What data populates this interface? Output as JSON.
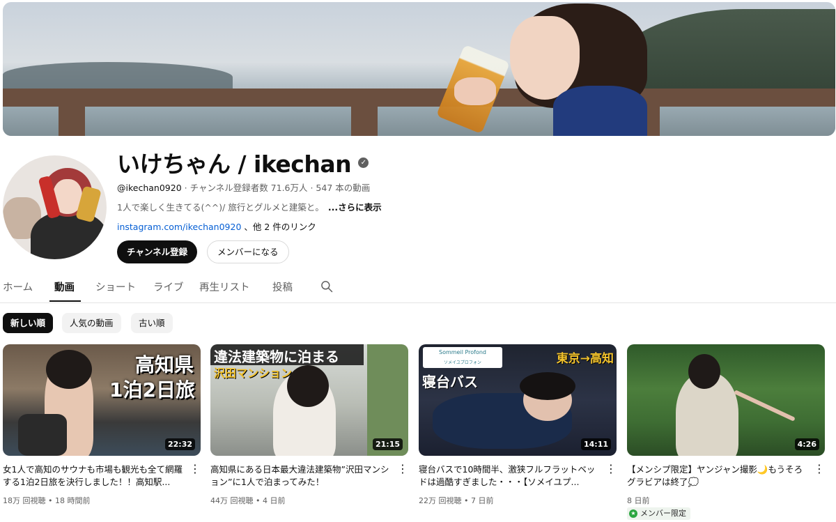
{
  "channel": {
    "name": "いけちゃん / ikechan",
    "verified_icon": "check-circle-icon",
    "handle": "@ikechan0920",
    "stats": " · チャンネル登録者数 71.6万人 · 547 本の動画",
    "description": "1人で楽しく生きてる(^^)/ 旅行とグルメと建築と。",
    "more": "...さらに表示",
    "link": "instagram.com/ikechan0920",
    "link_more": "、他 2 件のリンク",
    "subscribe_label": "チャンネル登録",
    "member_label": "メンバーになる"
  },
  "tabs": [
    {
      "label": "ホーム"
    },
    {
      "label": "動画"
    },
    {
      "label": "ショート"
    },
    {
      "label": "ライブ"
    },
    {
      "label": "再生リスト"
    },
    {
      "label": "投稿"
    }
  ],
  "active_tab": "動画",
  "filters": [
    {
      "label": "新しい順"
    },
    {
      "label": "人気の動画"
    },
    {
      "label": "古い順"
    }
  ],
  "videos": [
    {
      "title": "女1人で高知のサウナも市場も観光も全て網羅する1泊2日旅を決行しました！！高知駅...",
      "meta": "18万 回視聴 • 18 時間前",
      "duration": "22:32",
      "overlay1": "高知県",
      "overlay2": "1泊2日旅"
    },
    {
      "title": "高知県にある日本最大違法建築物”沢田マンション”に1人で泊まってみた！",
      "meta": "44万 回視聴 • 4 日前",
      "duration": "21:15",
      "overlay1": "違法建築物に泊まる",
      "overlay2": "沢田マンション"
    },
    {
      "title": "寝台バスで10時間半、激狭フルフラットベッドは過酷すぎました・・・【ソメイユプ...",
      "meta": "22万 回視聴 • 7 日前",
      "duration": "14:11",
      "overlay1": "東京→高知",
      "overlay2": "寝台バス",
      "logo": "Sommeil Profond",
      "logo_sub": "ソメイユプロフォン"
    },
    {
      "title": "【メンシプ限定】ヤンジャン撮影🌙もうそろグラビアは終了💭",
      "meta": "8 日前",
      "duration": "4:26",
      "badge": "メンバー限定"
    }
  ],
  "colors": {
    "accent_link": "#065fd4",
    "member_badge_green": "#2ba640"
  }
}
